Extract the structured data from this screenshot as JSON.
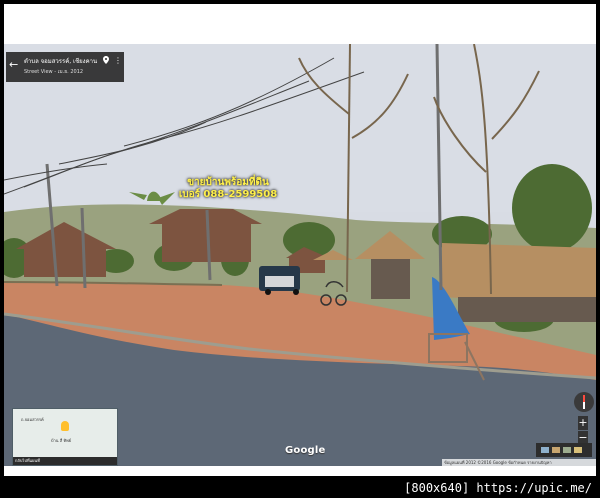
{
  "info_card": {
    "place": "ตำบล จอมสวรรค์, เชียงคาน",
    "subtitle": "Street View - เม.ย. 2012"
  },
  "overlay": {
    "line1": "ขายบ้านพร้อมที่ดิน",
    "line2": "เบอร์ 088-2599508"
  },
  "minimap": {
    "road": "ถ.จอมสวรรค์",
    "place": "บ้าน สี่ ทิพย์",
    "note": "กลับไปที่แผนที่"
  },
  "google_logo": "Google",
  "copyright": "ข้อมูลแผนที่ 2012 ©2016 Google  ข้อกำหนด  รายงานปัญหา",
  "watermark": "[800x640] https://upic.me/",
  "colors": {
    "overlay_text": "#fff04a",
    "sky": "#d9dde5",
    "road": "#5e6a78",
    "dirt": "#c98563"
  },
  "icons": [
    "back-arrow-icon",
    "map-pin-icon",
    "more-vert-icon",
    "compass-icon",
    "zoom-in-icon",
    "zoom-out-icon"
  ]
}
